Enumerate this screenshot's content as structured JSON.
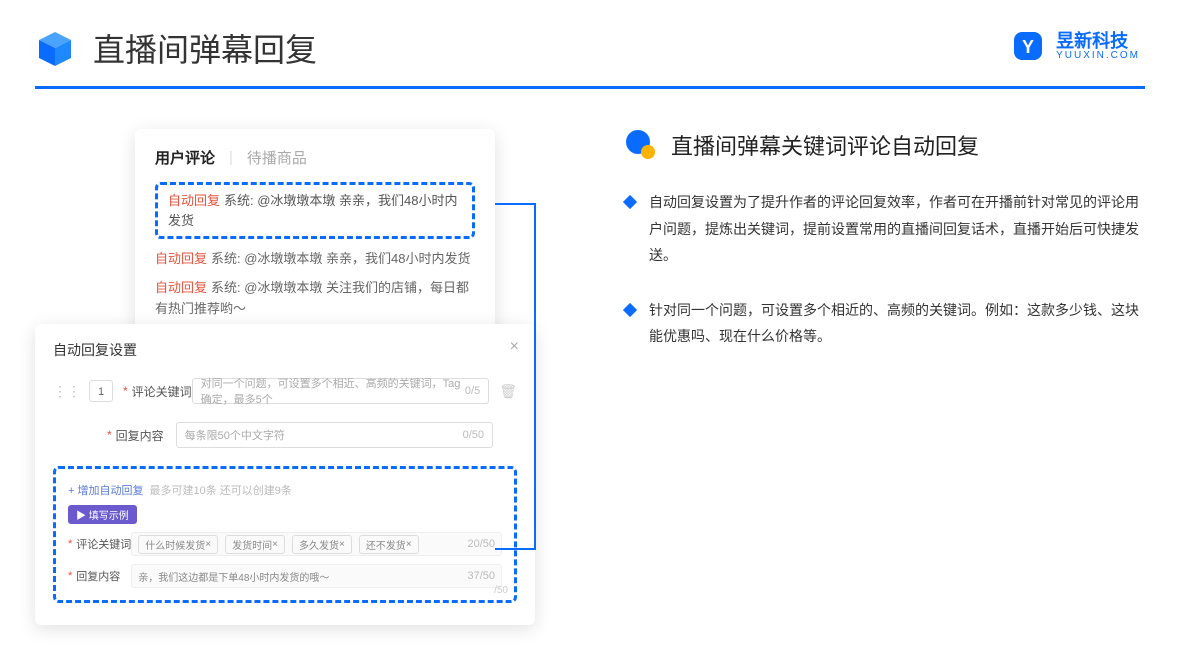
{
  "header": {
    "title": "直播间弹幕回复"
  },
  "brand": {
    "name": "昱新科技",
    "url": "YUUXIN.COM"
  },
  "commentsCard": {
    "tabActive": "用户评论",
    "tabInactive": "待播商品",
    "highlightedTag": "自动回复",
    "highlightedText": "系统: @冰墩墩本墩 亲亲，我们48小时内发货",
    "item2Tag": "自动回复",
    "item2Text": "系统: @冰墩墩本墩 亲亲，我们48小时内发货",
    "item3Tag": "自动回复",
    "item3Text": "系统: @冰墩墩本墩 关注我们的店铺，每日都有热门推荐哟～"
  },
  "settings": {
    "title": "自动回复设置",
    "rowNum": "1",
    "kwLabel": "评论关键词",
    "kwPlaceholder": "对同一个问题，可设置多个相近、高频的关键词，Tag确定，最多5个",
    "kwCount": "0/5",
    "contentLabel": "回复内容",
    "contentPlaceholder": "每条限50个中文字符",
    "contentCount": "0/50",
    "addLink": "+ 增加自动回复",
    "addHint": "最多可建10条 还可以创建9条",
    "badge": "▶ 填写示例",
    "exKwLabel": "评论关键词",
    "chip1": "什么时候发货",
    "chip2": "发货时间",
    "chip3": "多久发货",
    "chip4": "还不发货",
    "exKwCount": "20/50",
    "exContentLabel": "回复内容",
    "exContentText": "亲，我们这边都是下单48小时内发货的哦～",
    "exContentCount": "37/50",
    "stray": "/50"
  },
  "right": {
    "sectionTitle": "直播间弹幕关键词评论自动回复",
    "bullet1": "自动回复设置为了提升作者的评论回复效率，作者可在开播前针对常见的评论用户问题，提炼出关键词，提前设置常用的直播间回复话术，直播开始后可快捷发送。",
    "bullet2": "针对同一个问题，可设置多个相近的、高频的关键词。例如：这款多少钱、这块能优惠吗、现在什么价格等。"
  }
}
